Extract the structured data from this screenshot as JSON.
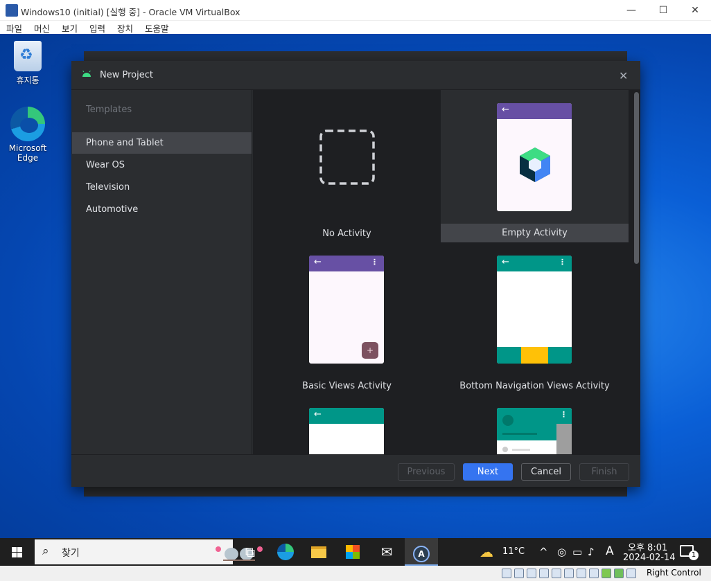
{
  "vbox": {
    "title": "Windows10 (initial) [실행 중] - Oracle VM VirtualBox",
    "window_controls": {
      "minimize": "—",
      "maximize": "☐",
      "close": "✕"
    },
    "menu": [
      "파일",
      "머신",
      "보기",
      "입력",
      "장치",
      "도움말"
    ],
    "status": {
      "host_key": "Right Control"
    }
  },
  "desktop": {
    "icons": [
      {
        "label": "휴지통",
        "icon": "recycle-bin-icon"
      },
      {
        "label": "Microsoft Edge",
        "icon": "edge-icon"
      }
    ]
  },
  "dialog": {
    "title": "New Project",
    "close": "✕",
    "sidebar": {
      "header": "Templates",
      "items": [
        {
          "label": "Phone and Tablet",
          "selected": true
        },
        {
          "label": "Wear OS",
          "selected": false
        },
        {
          "label": "Television",
          "selected": false
        },
        {
          "label": "Automotive",
          "selected": false
        }
      ]
    },
    "templates": [
      {
        "label": "No Activity"
      },
      {
        "label": "Empty Activity",
        "selected": true
      },
      {
        "label": "Basic Views Activity"
      },
      {
        "label": "Bottom Navigation Views Activity"
      }
    ],
    "buttons": {
      "previous": "Previous",
      "next": "Next",
      "cancel": "Cancel",
      "finish": "Finish"
    }
  },
  "taskbar": {
    "search_label": "찾기",
    "weather_temp": "11°C",
    "ime": "A",
    "time": "오후 8:01",
    "date": "2024-02-14",
    "notification_count": "1"
  },
  "colors": {
    "purple_appbar": "#6750a4",
    "teal_appbar": "#009688",
    "accent_blue": "#3574f0",
    "fab": "#7d5260",
    "bottom_nav_active": "#ffc107"
  }
}
